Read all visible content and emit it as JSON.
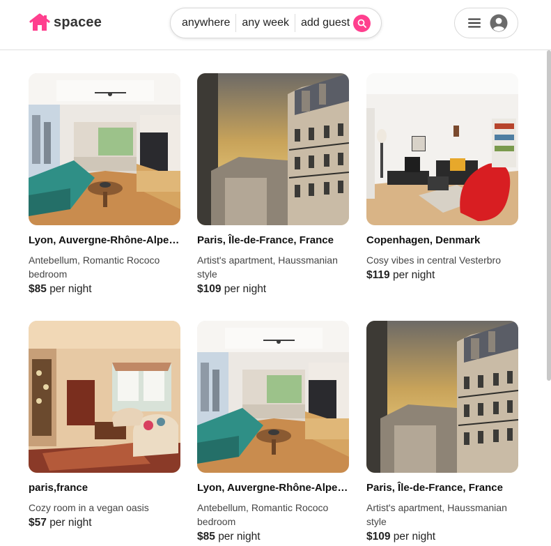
{
  "brand": {
    "name": "spacee",
    "accent": "#ff3f8e"
  },
  "search": {
    "location": "anywhere",
    "dates": "any week",
    "guests": "add guest",
    "icon": "search-icon"
  },
  "user_menu": {
    "menu_icon": "hamburger-icon",
    "avatar_icon": "user-avatar-icon"
  },
  "listings": [
    {
      "location": "Lyon, Auvergne-Rhône-Alpes, France",
      "description": "Antebellum, Romantic Rococo bedroom",
      "price": "$85",
      "unit": "per night",
      "photo": "bright-living-room"
    },
    {
      "location": "Paris, Île-de-France, France",
      "description": "Artist's apartment, Haussmanian style",
      "price": "$109",
      "unit": "per night",
      "photo": "paris-street-sunset"
    },
    {
      "location": "Copenhagen, Denmark",
      "description": "Cosy vibes in central Vesterbro",
      "price": "$119",
      "unit": "per night",
      "photo": "living-room-red-chair"
    },
    {
      "location": "paris,france",
      "description": "Cozy room in a vegan oasis",
      "price": "$57",
      "unit": "per night",
      "photo": "vintage-living-room"
    },
    {
      "location": "Lyon, Auvergne-Rhône-Alpes, France",
      "description": "Antebellum, Romantic Rococo bedroom",
      "price": "$85",
      "unit": "per night",
      "photo": "bright-living-room"
    },
    {
      "location": "Paris, Île-de-France, France",
      "description": "Artist's apartment, Haussmanian style",
      "price": "$109",
      "unit": "per night",
      "photo": "paris-street-sunset"
    }
  ]
}
